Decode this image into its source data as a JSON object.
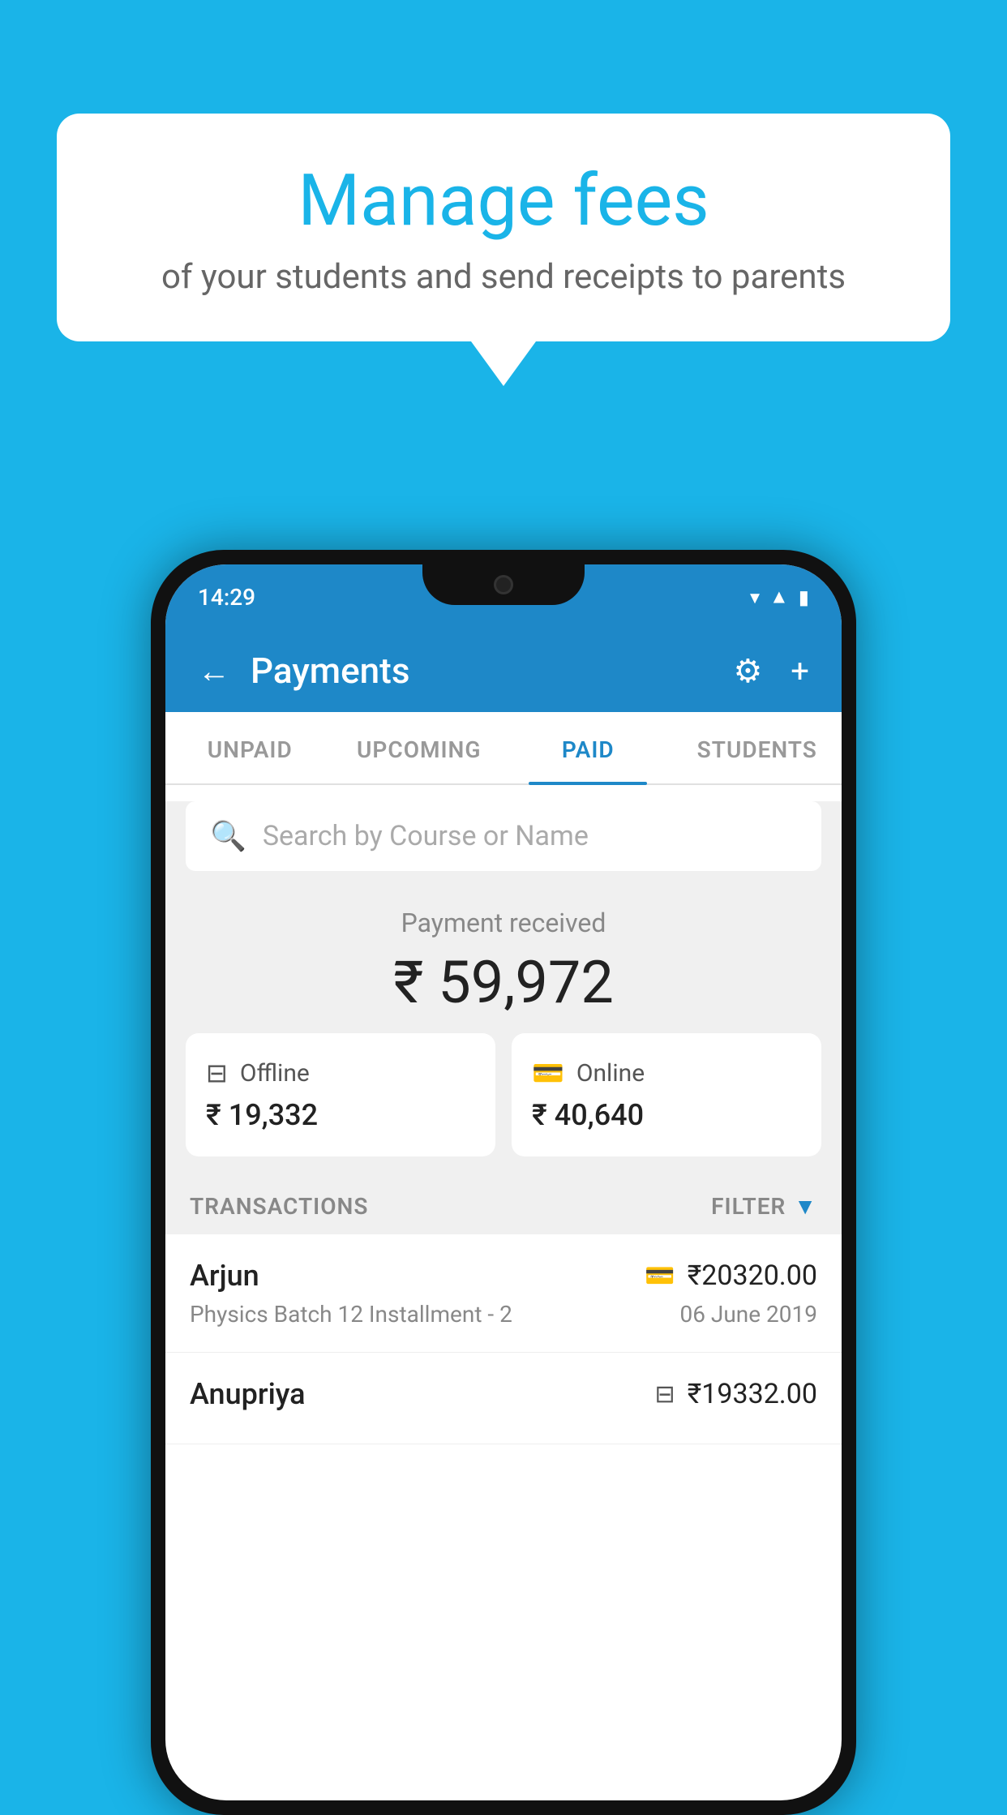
{
  "background_color": "#1ab4e8",
  "speech_bubble": {
    "title": "Manage fees",
    "subtitle": "of your students and send receipts to parents"
  },
  "phone": {
    "time": "14:29",
    "header": {
      "title": "Payments",
      "back_label": "←",
      "settings_label": "⚙",
      "add_label": "+"
    },
    "tabs": [
      {
        "label": "UNPAID",
        "active": false
      },
      {
        "label": "UPCOMING",
        "active": false
      },
      {
        "label": "PAID",
        "active": true
      },
      {
        "label": "STUDENTS",
        "active": false
      }
    ],
    "search": {
      "placeholder": "Search by Course or Name"
    },
    "payment_summary": {
      "label": "Payment received",
      "amount": "₹ 59,972",
      "offline": {
        "label": "Offline",
        "amount": "₹ 19,332"
      },
      "online": {
        "label": "Online",
        "amount": "₹ 40,640"
      }
    },
    "transactions_label": "TRANSACTIONS",
    "filter_label": "FILTER",
    "transactions": [
      {
        "name": "Arjun",
        "amount": "₹20320.00",
        "course": "Physics Batch 12 Installment - 2",
        "date": "06 June 2019",
        "payment_type": "online"
      },
      {
        "name": "Anupriya",
        "amount": "₹19332.00",
        "course": "",
        "date": "",
        "payment_type": "offline"
      }
    ]
  }
}
